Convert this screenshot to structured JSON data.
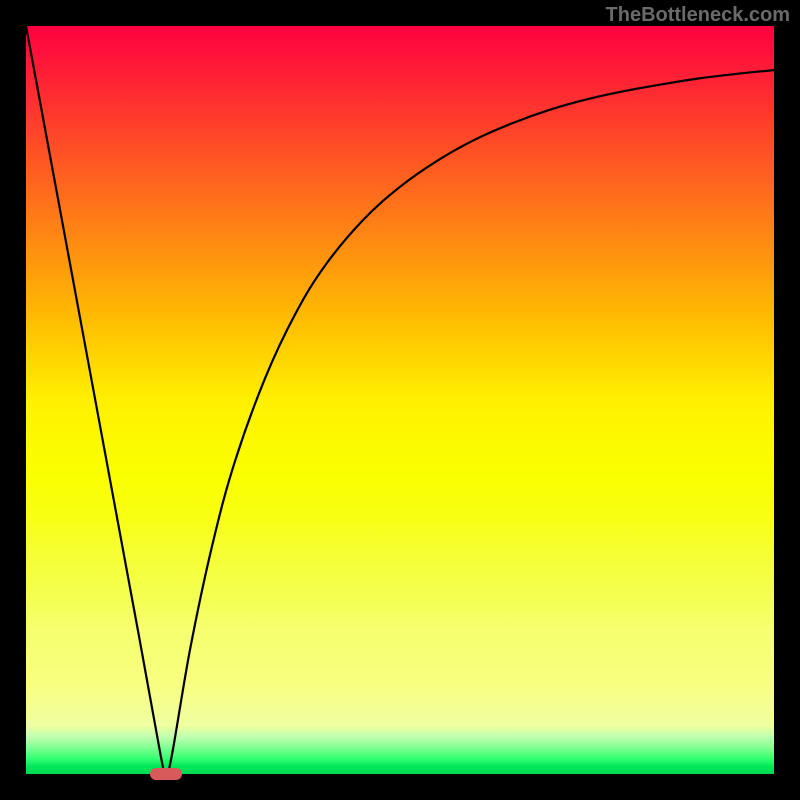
{
  "watermark": "TheBottleneck.com",
  "chart_data": {
    "type": "line",
    "title": "",
    "xlabel": "",
    "ylabel": "",
    "x_range": [
      0,
      100
    ],
    "y_range": [
      0,
      100
    ],
    "series": [
      {
        "name": "curve",
        "x": [
          0,
          5,
          10,
          15,
          18,
          18.7,
          19.5,
          22,
          25,
          28,
          32,
          36,
          40,
          45,
          50,
          55,
          60,
          65,
          70,
          75,
          80,
          85,
          90,
          95,
          100
        ],
        "values": [
          100,
          73,
          46,
          19,
          2.5,
          0,
          2.5,
          17,
          31,
          42,
          53,
          61.5,
          68,
          74,
          78.5,
          82,
          84.8,
          87,
          88.8,
          90.2,
          91.3,
          92.2,
          93,
          93.6,
          94.1
        ]
      }
    ],
    "marker": {
      "x": 18.7,
      "y": 0,
      "width_pct": 4.3,
      "height_pct": 1.5
    },
    "background_gradient": {
      "top": "#ff0040",
      "bottom": "#00d850"
    }
  }
}
